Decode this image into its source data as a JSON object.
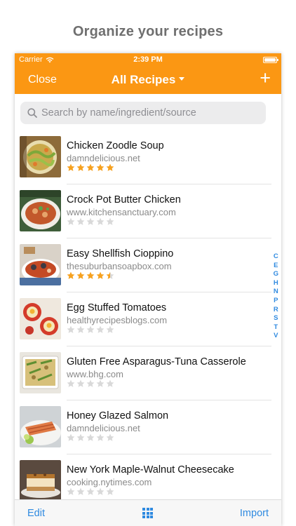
{
  "headline": "Organize your recipes",
  "status_bar": {
    "carrier": "Carrier",
    "time": "2:39 PM"
  },
  "nav": {
    "close_label": "Close",
    "title": "All Recipes",
    "add_label": "+"
  },
  "search": {
    "placeholder": "Search by name/ingredient/source"
  },
  "colors": {
    "accent": "#fb9713",
    "link": "#2f8ae0",
    "star_on": "#f6a11f",
    "star_off": "#d9d9d9"
  },
  "recipes": [
    {
      "name": "Chicken Zoodle Soup",
      "source": "damndelicious.net",
      "rating": 5
    },
    {
      "name": "Crock Pot Butter Chicken",
      "source": "www.kitchensanctuary.com",
      "rating": 0
    },
    {
      "name": "Easy Shellfish Cioppino",
      "source": "thesuburbansoapbox.com",
      "rating": 4.5
    },
    {
      "name": "Egg Stuffed Tomatoes",
      "source": "healthyrecipesblogs.com",
      "rating": 0
    },
    {
      "name": "Gluten Free Asparagus-Tuna Casserole",
      "source": "www.bhg.com",
      "rating": 0
    },
    {
      "name": "Honey Glazed Salmon",
      "source": "damndelicious.net",
      "rating": 0
    },
    {
      "name": "New York Maple-Walnut Cheesecake",
      "source": "cooking.nytimes.com",
      "rating": 0
    }
  ],
  "section_index": [
    "C",
    "E",
    "G",
    "H",
    "N",
    "P",
    "R",
    "S",
    "T",
    "V"
  ],
  "toolbar": {
    "edit_label": "Edit",
    "grid_icon": "grid-icon",
    "import_label": "Import"
  }
}
